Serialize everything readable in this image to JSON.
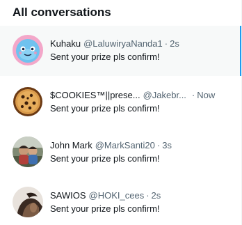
{
  "header": {
    "title": "All conversations"
  },
  "conversations": [
    {
      "name": "Kuhaku",
      "handle": "@LaluwiryaNanda1",
      "separator": "·",
      "time": "2s",
      "message": "Sent your prize pls confirm!"
    },
    {
      "name": "$COOKIES™||prese...",
      "handle": "@Jakebr...",
      "separator": "·",
      "time": "Now",
      "message": "Sent your prize pls confirm!"
    },
    {
      "name": "John Mark",
      "handle": "@MarkSanti20",
      "separator": "·",
      "time": "3s",
      "message": "Sent your prize pls confirm!"
    },
    {
      "name": "SAWIOS",
      "handle": "@HOKI_cees",
      "separator": "·",
      "time": "2s",
      "message": "Sent your prize pls confirm!"
    }
  ],
  "colors": {
    "selected_background": "#f7f9f9",
    "selected_accent": "#1d9bf0",
    "primary_text": "#0f1419",
    "secondary_text": "#536471"
  }
}
